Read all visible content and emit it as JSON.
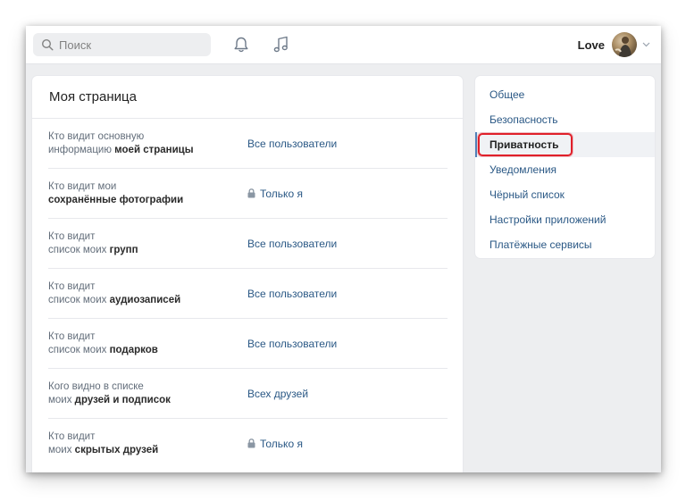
{
  "topbar": {
    "search_placeholder": "Поиск",
    "user_name": "Love"
  },
  "main": {
    "title": "Моя страница",
    "rows": [
      {
        "label_pre": "Кто видит основную",
        "label_mid": "информацию ",
        "label_bold": "моей страницы",
        "value": "Все пользователи",
        "locked": false
      },
      {
        "label_pre": "Кто видит мои",
        "label_mid": "",
        "label_bold": "сохранённые фотографии",
        "value": "Только я",
        "locked": true
      },
      {
        "label_pre": "Кто видит",
        "label_mid": "список моих ",
        "label_bold": "групп",
        "value": "Все пользователи",
        "locked": false
      },
      {
        "label_pre": "Кто видит",
        "label_mid": "список моих ",
        "label_bold": "аудиозаписей",
        "value": "Все пользователи",
        "locked": false
      },
      {
        "label_pre": "Кто видит",
        "label_mid": "список моих ",
        "label_bold": "подарков",
        "value": "Все пользователи",
        "locked": false
      },
      {
        "label_pre": "Кого видно в списке",
        "label_mid": "моих ",
        "label_bold": "друзей и подписок",
        "value": "Всех друзей",
        "locked": false
      },
      {
        "label_pre": "Кто видит",
        "label_mid": "моих ",
        "label_bold": "скрытых друзей",
        "value": "Только я",
        "locked": true
      }
    ]
  },
  "sidebar": {
    "items": [
      {
        "label": "Общее"
      },
      {
        "label": "Безопасность"
      },
      {
        "label": "Приватность"
      },
      {
        "label": "Уведомления"
      },
      {
        "label": "Чёрный список"
      },
      {
        "label": "Настройки приложений"
      },
      {
        "label": "Платёжные сервисы"
      }
    ],
    "active_index": 2
  },
  "colors": {
    "accent": "#2a5885",
    "highlight": "#e0202a",
    "background": "#edeef0"
  },
  "icons": {
    "search": "search-icon",
    "notifications": "bell-icon",
    "music": "music-note-icon",
    "lock": "lock-icon",
    "dropdown": "chevron-down-icon"
  }
}
